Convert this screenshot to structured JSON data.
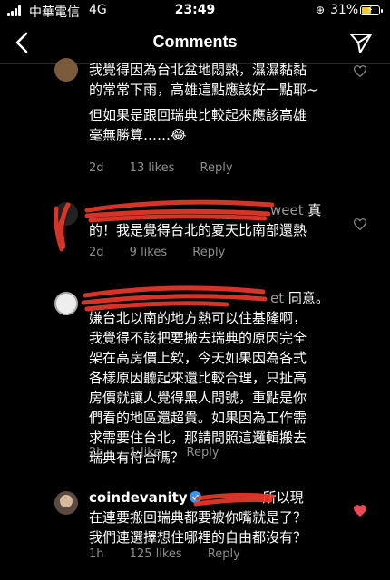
{
  "status_bar": {
    "carrier": "中華電信",
    "network": "4G",
    "time": "23:49",
    "battery": "31%",
    "battery_level": 0.31
  },
  "header": {
    "title": "Comments"
  },
  "colors": {
    "background": "#000000",
    "meta": "#8e8e8e",
    "like_active": "#ed4956",
    "redaction": "#e8382a"
  },
  "comments": [
    {
      "lines": [
        "我覺得因為台北盆地悶熱，濕濕黏黏",
        "的常常下雨，高雄這點應該好一點耶~",
        "但如果是跟回瑞典比較起來應該高雄",
        "毫無勝算……😂"
      ],
      "time": "2d",
      "likes": "13 likes",
      "reply": "Reply"
    },
    {
      "username_tail": "weet",
      "lines_after": [
        "真",
        "的！我是覺得台北的夏天比南部還熱"
      ],
      "time": "2d",
      "likes": "9 likes",
      "reply": "Reply"
    },
    {
      "username_tail": "et",
      "after_name": "同意。",
      "lines": [
        "嫌台北以南的地方熱可以住基隆啊，",
        "我覺得不該把要搬去瑞典的原因完全",
        "架在高房價上欸，今天如果因為各式",
        "各樣原因聽起來還比較合理，只扯高",
        "房價就讓人覺得黑人問號，重點是你",
        "們看的地區還超貴。如果因為工作需",
        "求需要住台北，那請問照這邏輯搬去",
        "瑞典有符合嗎？"
      ],
      "time": "2h",
      "likes": "1 like",
      "reply": "Reply"
    },
    {
      "username": "coindevanity",
      "after_name": "所以現",
      "lines": [
        "在連要搬回瑞典都要被你嘴就是了？",
        "我們連選擇想住哪裡的自由都沒有？"
      ],
      "time": "1h",
      "likes": "125 likes",
      "reply": "Reply"
    }
  ],
  "icons": {
    "back": "chevron-left-icon",
    "send": "paper-plane-icon",
    "like": "heart-icon",
    "verified": "verified-badge-icon"
  }
}
